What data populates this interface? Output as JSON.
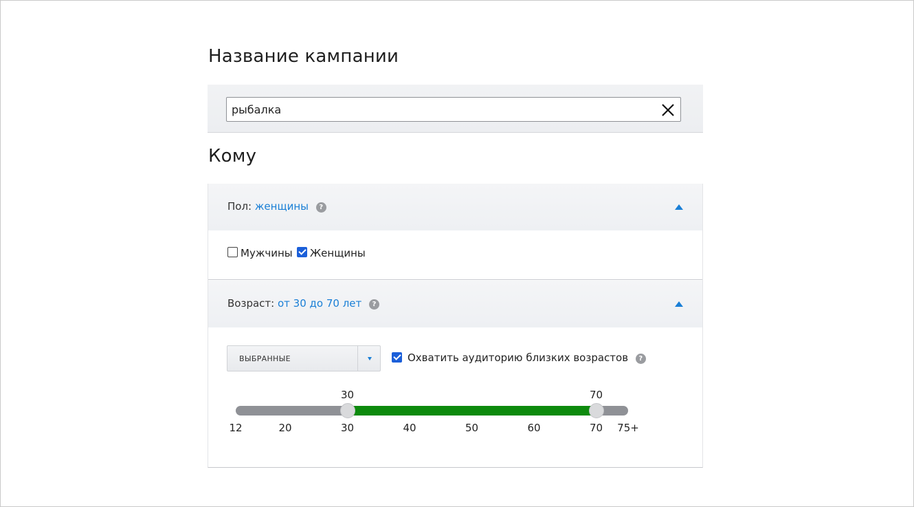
{
  "campaign": {
    "heading": "Название кампании",
    "name_value": "рыбалка",
    "clear_icon": "close-icon"
  },
  "audience": {
    "heading": "Кому",
    "gender": {
      "label": "Пол:",
      "value": "женщины",
      "help": "?",
      "options": [
        {
          "label": "Мужчины",
          "checked": false
        },
        {
          "label": "Женщины",
          "checked": true
        }
      ]
    },
    "age": {
      "label": "Возраст:",
      "value": "от 30 до 70 лет",
      "help": "?",
      "mode": "ВЫБРАННЫЕ",
      "nearby_label": "Охватить аудиторию близких возрастов",
      "nearby_checked": true,
      "range_min": 12,
      "range_max": 75,
      "selected_min": 30,
      "selected_max": 70,
      "selected_min_label": "30",
      "selected_max_label": "70",
      "ticks": [
        "12",
        "20",
        "30",
        "40",
        "50",
        "60",
        "70",
        "75+"
      ]
    }
  },
  "colors": {
    "accent": "#1a7fd6",
    "checkbox": "#1b5fd9",
    "range_fill": "#0d8a0d",
    "track": "#8f9196"
  }
}
